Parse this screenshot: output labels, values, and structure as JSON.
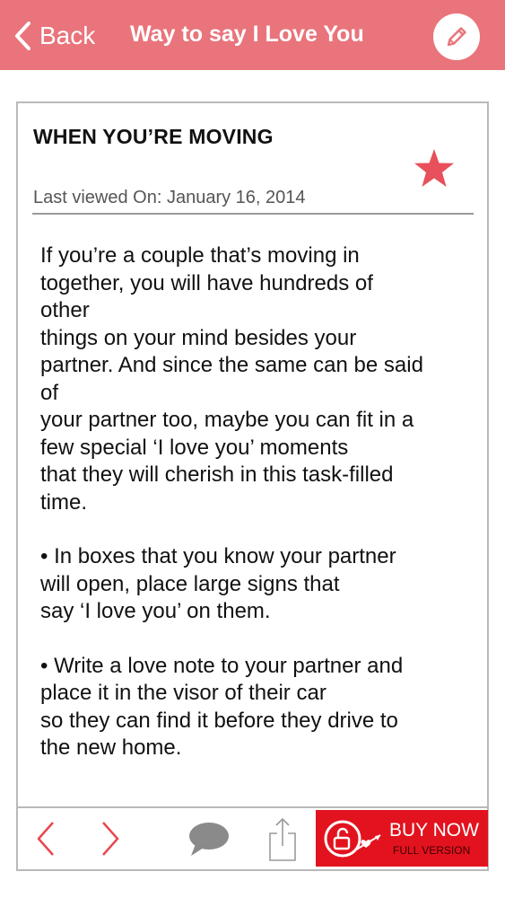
{
  "navbar": {
    "back_label": "Back",
    "title": "Way to say I Love You",
    "edit_icon": "pencil-icon",
    "background": "#e9747b"
  },
  "article": {
    "title": "WHEN YOU’RE MOVING",
    "favorite_icon": "star-icon",
    "favorite_color": "#e8505b",
    "last_viewed": "Last viewed On: January 16, 2014",
    "paragraphs": [
      "If you’re a couple that’s moving in\ntogether, you will have hundreds of\nother\nthings on your mind besides your\npartner. And since the same can be said\nof\nyour partner too, maybe you can fit in a\nfew special ‘I love you’ moments\nthat they will cherish in this task-filled\ntime.",
      "• In boxes that you know your partner\nwill open, place large signs that\nsay ‘I love you’ on them.",
      "• Write a love note to your partner and\nplace it in the visor of their car\nso they can find it before they drive to\nthe new home."
    ]
  },
  "toolbar": {
    "prev_icon": "chevron-left-icon",
    "next_icon": "chevron-right-icon",
    "comment_icon": "speech-bubble-icon",
    "share_icon": "share-icon",
    "buy_main": "BUY NOW",
    "buy_sub": "FULL VERSION",
    "buy_color": "#e2131e"
  }
}
